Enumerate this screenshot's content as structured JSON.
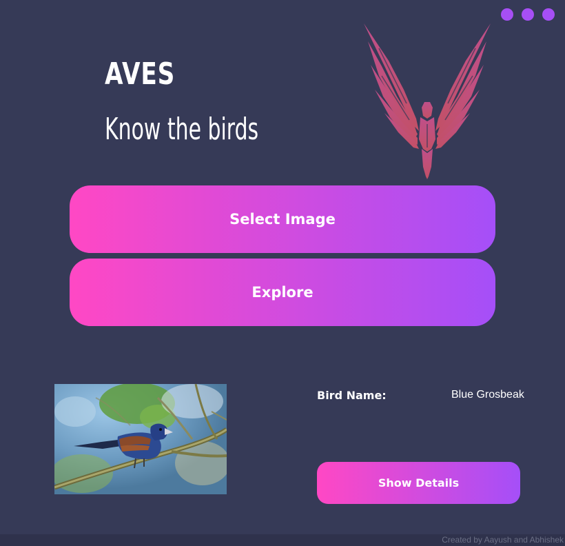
{
  "window": {
    "controls": [
      "dot",
      "dot",
      "dot"
    ],
    "control_color": "#a64ff5",
    "background_color": "#363a57"
  },
  "header": {
    "title": "AVES",
    "subtitle": "Know the birds",
    "logo_icon": "eagle-logo-icon",
    "logo_color": "#c2506f"
  },
  "actions": {
    "select_image_label": "Select Image",
    "explore_label": "Explore",
    "gradient_start": "#ff48c4",
    "gradient_end": "#a54ff8"
  },
  "result": {
    "image_subject": "blue-grosbeak-photo",
    "bird_name_label": "Bird Name:",
    "bird_name_value": "Blue Grosbeak",
    "show_details_label": "Show Details"
  },
  "footer": {
    "credit": "Created by Aayush and Abhishek"
  }
}
